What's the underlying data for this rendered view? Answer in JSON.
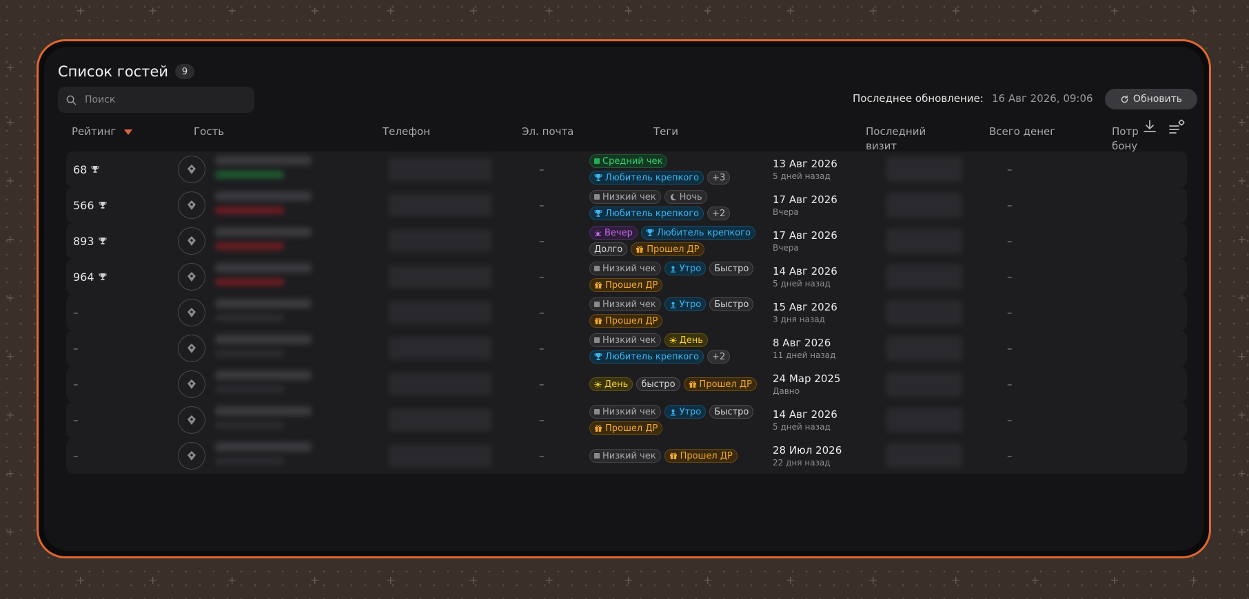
{
  "header": {
    "title": "Список гостей",
    "count": "9",
    "search_placeholder": "Поиск",
    "last_update_label": "Последнее обновление:",
    "last_update_value": "16 Авг 2026, 09:06",
    "refresh_label": "Обновить"
  },
  "columns": {
    "rating": "Рейтинг",
    "guest": "Гость",
    "phone": "Телефон",
    "email": "Эл. почта",
    "tags": "Теги",
    "last_visit_1": "Последний",
    "last_visit_2": "визит",
    "total_money": "Всего денег",
    "bonus_1": "Потр",
    "bonus_2": "бону"
  },
  "rows": [
    {
      "rating": "68",
      "email": "–",
      "bonus": "–",
      "date": "13 Авг 2026",
      "ago": "5 дней назад",
      "tags": [
        [
          {
            "label": "Средний чек",
            "style": "green",
            "icon": "square-icon"
          }
        ],
        [
          {
            "label": "Любитель крепкого",
            "style": "blue",
            "icon": "trophy-icon"
          },
          {
            "label": "+3",
            "style": "more"
          }
        ]
      ]
    },
    {
      "rating": "566",
      "email": "–",
      "bonus": "–",
      "date": "17 Авг 2026",
      "ago": "Вчера",
      "tags": [
        [
          {
            "label": "Низкий чек",
            "style": "gray",
            "icon": "square-icon"
          },
          {
            "label": "Ночь",
            "style": "gray",
            "icon": "moon-icon"
          }
        ],
        [
          {
            "label": "Любитель крепкого",
            "style": "blue",
            "icon": "trophy-icon"
          },
          {
            "label": "+2",
            "style": "more"
          }
        ]
      ]
    },
    {
      "rating": "893",
      "email": "–",
      "bonus": "–",
      "date": "17 Авг 2026",
      "ago": "Вчера",
      "tags": [
        [
          {
            "label": "Вечер",
            "style": "purple",
            "icon": "sunset-icon"
          },
          {
            "label": "Любитель крепкого",
            "style": "blue",
            "icon": "trophy-icon"
          }
        ],
        [
          {
            "label": "Долго",
            "style": "plain"
          },
          {
            "label": "Прошел ДР",
            "style": "orange",
            "icon": "gift-icon"
          }
        ]
      ]
    },
    {
      "rating": "964",
      "email": "–",
      "bonus": "–",
      "date": "14 Авг 2026",
      "ago": "5 дней назад",
      "tags": [
        [
          {
            "label": "Низкий чек",
            "style": "gray",
            "icon": "square-icon"
          },
          {
            "label": "Утро",
            "style": "blue",
            "icon": "sunrise-icon"
          },
          {
            "label": "Быстро",
            "style": "plain"
          }
        ],
        [
          {
            "label": "Прошел ДР",
            "style": "orange",
            "icon": "gift-icon"
          }
        ]
      ]
    },
    {
      "rating": "–",
      "email": "–",
      "bonus": "–",
      "date": "15 Авг 2026",
      "ago": "3 дня назад",
      "tags": [
        [
          {
            "label": "Низкий чек",
            "style": "gray",
            "icon": "square-icon"
          },
          {
            "label": "Утро",
            "style": "blue",
            "icon": "sunrise-icon"
          },
          {
            "label": "Быстро",
            "style": "plain"
          }
        ],
        [
          {
            "label": "Прошел ДР",
            "style": "orange",
            "icon": "gift-icon"
          }
        ]
      ]
    },
    {
      "rating": "–",
      "email": "–",
      "bonus": "–",
      "date": "8 Авг 2026",
      "ago": "11 дней назад",
      "tags": [
        [
          {
            "label": "Низкий чек",
            "style": "gray",
            "icon": "square-icon"
          },
          {
            "label": "День",
            "style": "yellow",
            "icon": "sun-icon"
          }
        ],
        [
          {
            "label": "Любитель крепкого",
            "style": "blue",
            "icon": "trophy-icon"
          },
          {
            "label": "+2",
            "style": "more"
          }
        ]
      ]
    },
    {
      "rating": "–",
      "email": "–",
      "bonus": "–",
      "date": "24 Мар 2025",
      "ago": "Давно",
      "tags": [
        [
          {
            "label": "День",
            "style": "yellow",
            "icon": "sun-icon"
          },
          {
            "label": "быстро",
            "style": "plain"
          },
          {
            "label": "Прошел ДР",
            "style": "orange",
            "icon": "gift-icon"
          }
        ]
      ]
    },
    {
      "rating": "–",
      "email": "–",
      "bonus": "–",
      "date": "14 Авг 2026",
      "ago": "5 дней назад",
      "tags": [
        [
          {
            "label": "Низкий чек",
            "style": "gray",
            "icon": "square-icon"
          },
          {
            "label": "Утро",
            "style": "blue",
            "icon": "sunrise-icon"
          },
          {
            "label": "Быстро",
            "style": "plain"
          }
        ],
        [
          {
            "label": "Прошел ДР",
            "style": "orange",
            "icon": "gift-icon"
          }
        ]
      ]
    },
    {
      "rating": "–",
      "email": "–",
      "bonus": "–",
      "date": "28 Июл 2026",
      "ago": "22 дня назад",
      "tags": [
        [
          {
            "label": "Низкий чек",
            "style": "gray",
            "icon": "square-icon"
          },
          {
            "label": "Прошел ДР",
            "style": "orange",
            "icon": "gift-icon"
          }
        ]
      ]
    }
  ],
  "colors": {
    "accent_frame": "#e2672e",
    "sort_arrow": "#e0643a"
  }
}
